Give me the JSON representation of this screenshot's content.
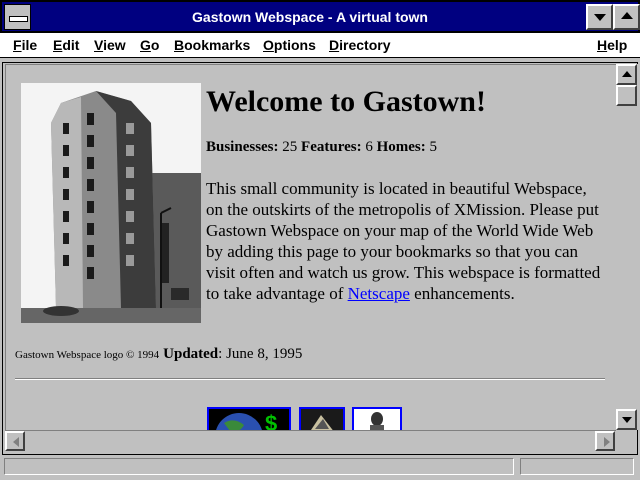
{
  "window": {
    "title": "Gastown Webspace - A virtual town",
    "icons": {
      "system_menu": "system-menu-icon",
      "minimize": "minimize-icon",
      "maximize": "maximize-icon"
    }
  },
  "menu": [
    {
      "label": "File",
      "accel": "F",
      "rest": "ile"
    },
    {
      "label": "Edit",
      "accel": "E",
      "rest": "dit"
    },
    {
      "label": "View",
      "accel": "V",
      "rest": "iew"
    },
    {
      "label": "Go",
      "accel": "G",
      "rest": "o"
    },
    {
      "label": "Bookmarks",
      "accel": "B",
      "rest": "ookmarks"
    },
    {
      "label": "Options",
      "accel": "O",
      "rest": "ptions"
    },
    {
      "label": "Directory",
      "accel": "D",
      "rest": "irectory"
    },
    {
      "label": "Help",
      "accel": "H",
      "rest": "elp"
    }
  ],
  "page": {
    "heading": "Welcome to Gastown!",
    "stats": {
      "businesses_label": "Businesses:",
      "businesses_value": "25",
      "features_label": "Features:",
      "features_value": "6",
      "homes_label": "Homes:",
      "homes_value": "5"
    },
    "intro_text": "This small community is located in beautiful Webspace, on the outskirts of the metropolis of XMission. Please put Gastown Webspace on your map of the World Wide Web by adding this page to your bookmarks so that you can visit often and watch us grow. This webspace is formatted to take advantage of ",
    "intro_link": "Netscape",
    "intro_tail": " enhancements.",
    "logo_credit": "Gastown Webspace logo © 1994",
    "updated_label": "Updated",
    "updated_date": ": June 8, 1995",
    "image": "flatiron-building-photo",
    "thumbnails": [
      "globe-dollar-icon",
      "eagle-icon",
      "figure-icon"
    ]
  },
  "colors": {
    "titlebar": "#000080",
    "link": "#0000ff",
    "chrome": "#c0c0c0"
  },
  "scrollbars": {
    "vertical": {
      "up": "arrow-up-icon",
      "down": "arrow-down-icon"
    },
    "horizontal": {
      "left": "arrow-left-icon",
      "right": "arrow-right-icon"
    }
  }
}
